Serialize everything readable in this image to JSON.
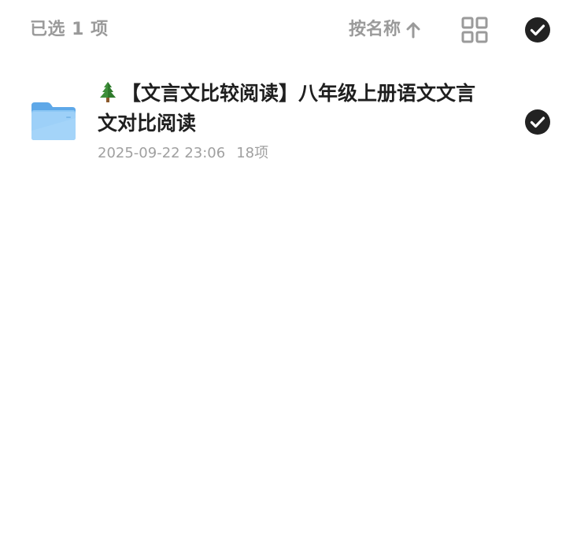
{
  "header": {
    "selected_count": "已选 1 项",
    "sort_label": "按名称",
    "sort_direction_icon": "arrow-up-icon",
    "view_icon": "grid-icon",
    "select_all_icon": "check-circle-icon"
  },
  "files": [
    {
      "emoji": "tree-icon",
      "title": "【文言文比较阅读】八年级上册语文文言文对比阅读",
      "date": "2025-09-22 23:06",
      "count": "18项",
      "selected": true,
      "type_icon": "folder-icon"
    }
  ],
  "colors": {
    "text_muted": "#9a9a9a",
    "text_primary": "#1f1f1f",
    "check_fill": "#222222",
    "folder_blue": "#6fb3ef"
  }
}
